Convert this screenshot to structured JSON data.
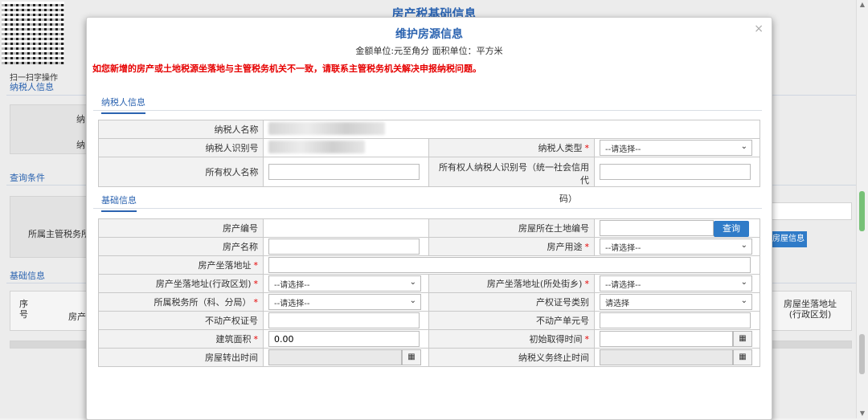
{
  "background": {
    "page_title": "房产税基础信息",
    "scan_label": "扫一扫字操作",
    "taxpayer_tab": "纳税人信息",
    "query_tab": "查询条件",
    "basic_tab": "基础信息",
    "left_label_1": "纳",
    "left_label_2": "纳",
    "left_label_3": "所属主管税务所",
    "house_info_btn": "房屋信息",
    "table_seq_header": "序\n号",
    "table_col2_header": "房产",
    "table_right_header": "房屋坐落地址\n(行政区划)"
  },
  "modal": {
    "title": "维护房源信息",
    "subtitle": "金额单位:元至角分 面积单位：平方米",
    "close": "×",
    "warning": "如您新增的房产或土地税源坐落地与主管税务机关不一致，请联系主管税务机关解决申报纳税问题。",
    "taxpayer_section": {
      "tab": "纳税人信息",
      "name_label": "纳税人名称",
      "id_label": "纳税人识别号",
      "type_label": "纳税人类型",
      "type_value": "--请选择--",
      "owner_label": "所有权人名称",
      "owner_id_label": "所有权人纳税人识别号（统一社会信用代码）",
      "owner_id_label_line1": "所有权人纳税人识别号（统一社会信用代",
      "owner_id_label_line2": "码）"
    },
    "basic_section": {
      "tab": "基础信息",
      "house_no_label": "房产编号",
      "land_no_label": "房屋所在土地编号",
      "query_button": "查询",
      "house_name_label": "房产名称",
      "usage_label": "房产用途",
      "usage_value": "--请选择--",
      "address_label": "房产坐落地址",
      "district_label": "房产坐落地址(行政区划)",
      "district_value": "--请选择--",
      "street_label": "房产坐落地址(所处街乡)",
      "street_value": "--请选择--",
      "office_label": "所属税务所（科、分局）",
      "office_value": "--请选择--",
      "cert_type_label": "产权证号类别",
      "cert_type_value": "请选择",
      "estate_cert_label": "不动产权证号",
      "estate_unit_label": "不动产单元号",
      "area_label": "建筑面积",
      "area_value": "0.00",
      "acquire_time_label": "初始取得时间",
      "transfer_time_label": "房屋转出时间",
      "obligation_end_label": "纳税义务终止时间"
    }
  }
}
